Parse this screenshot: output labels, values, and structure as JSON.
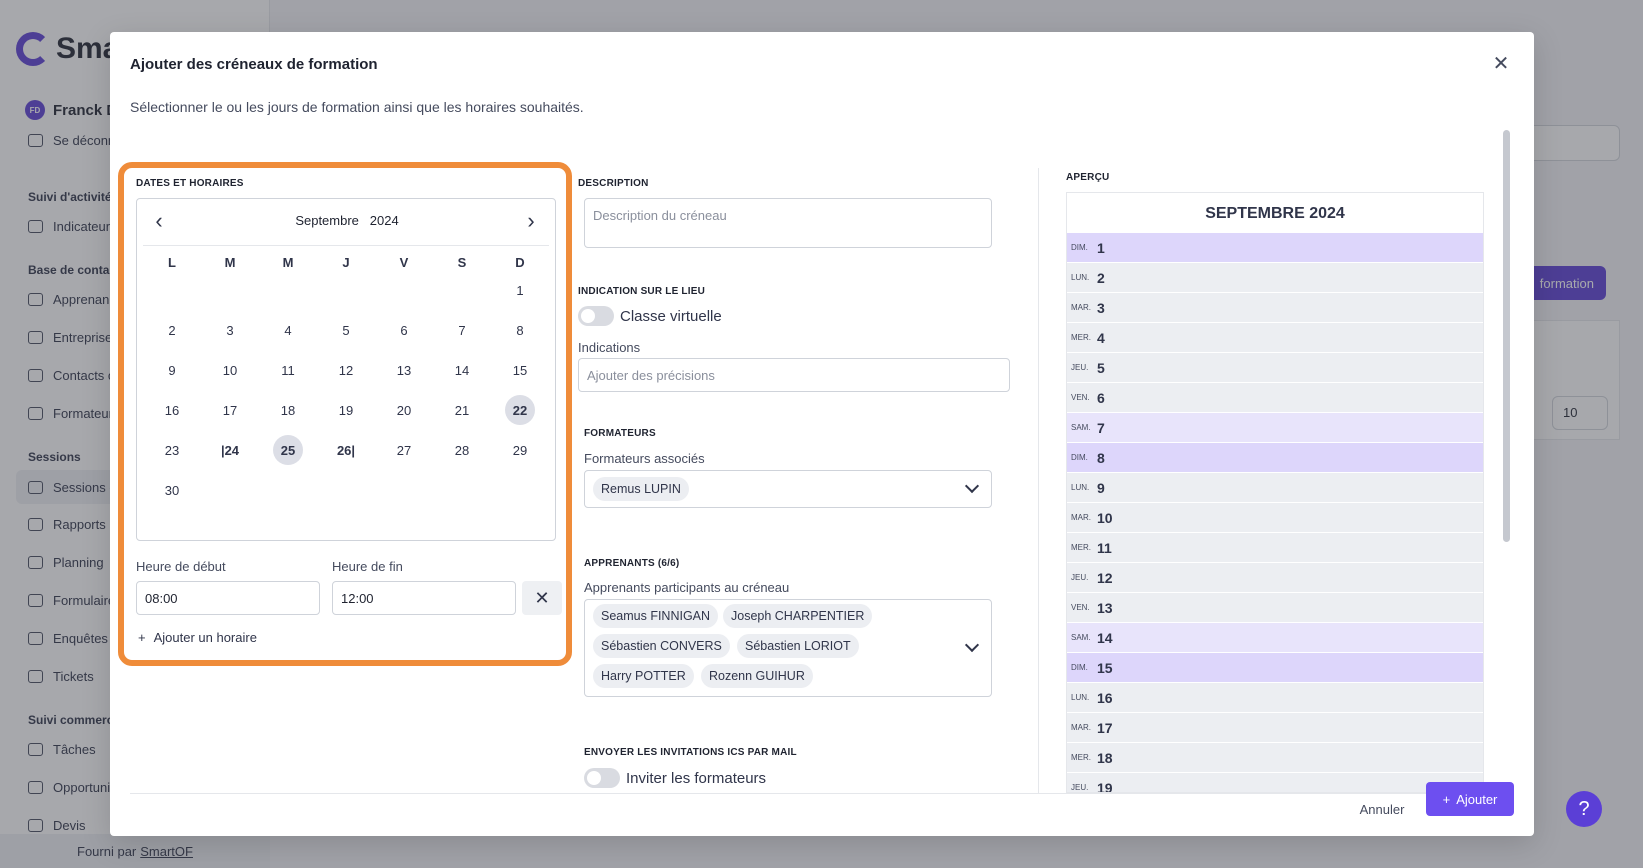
{
  "background": {
    "logo_text": "Sma",
    "user": {
      "initials": "FD",
      "name": "Franck D"
    },
    "logout": "Se déconn",
    "groups": [
      "Suivi d'activité",
      "Base de conta",
      "Sessions",
      "Suivi commerc"
    ],
    "items": [
      "Indicateur",
      "Apprenan",
      "Entreprise",
      "Contacts c",
      "Formateur",
      "Sessions d",
      "Rapports",
      "Planning",
      "Formulaire",
      "Enquêtes",
      "Tickets",
      "Tâches",
      "Opportunit",
      "Devis"
    ],
    "footer_prefix": "Fourni par",
    "footer_link": "SmartOF",
    "right_button": "formation",
    "page_size": "10",
    "help": "?"
  },
  "modal": {
    "title": "Ajouter des créneaux de formation",
    "subtitle": "Sélectionner le ou les jours de formation ainsi que les horaires souhaités.",
    "close": "✕",
    "cancel": "Annuler",
    "add": "Ajouter"
  },
  "dates": {
    "section": "DATES ET HORAIRES",
    "month": "Septembre",
    "year": "2024",
    "weekdays": [
      "L",
      "M",
      "M",
      "J",
      "V",
      "S",
      "D"
    ],
    "days": [
      "1",
      "2",
      "3",
      "4",
      "5",
      "6",
      "7",
      "8",
      "9",
      "10",
      "11",
      "12",
      "13",
      "14",
      "15",
      "16",
      "17",
      "18",
      "19",
      "20",
      "21",
      "22",
      "23",
      "|24",
      "25",
      "26|",
      "27",
      "28",
      "29",
      "30"
    ],
    "start_label": "Heure de début",
    "start_value": "08:00",
    "end_label": "Heure de fin",
    "end_value": "12:00",
    "add_hour": "Ajouter un horaire"
  },
  "description": {
    "section": "DESCRIPTION",
    "placeholder": "Description du créneau"
  },
  "location": {
    "section": "INDICATION SUR LE LIEU",
    "virtual_label": "Classe virtuelle",
    "indications_label": "Indications",
    "indications_placeholder": "Ajouter des précisions"
  },
  "trainers": {
    "section": "FORMATEURS",
    "label": "Formateurs associés",
    "selected": [
      "Remus LUPIN"
    ]
  },
  "learners": {
    "section": "APPRENANTS (6/6)",
    "label": "Apprenants participants au créneau",
    "selected": [
      "Seamus FINNIGAN",
      "Joseph CHARPENTIER",
      "Sébastien CONVERS",
      "Sébastien LORIOT",
      "Harry POTTER",
      "Rozenn GUIHUR"
    ]
  },
  "ics": {
    "section": "ENVOYER LES INVITATIONS ICS PAR MAIL",
    "invite_trainers": "Inviter les formateurs"
  },
  "preview": {
    "section": "APERÇU",
    "title": "SEPTEMBRE 2024",
    "rows": [
      {
        "dow": "DIM.",
        "num": "1"
      },
      {
        "dow": "LUN.",
        "num": "2"
      },
      {
        "dow": "MAR.",
        "num": "3"
      },
      {
        "dow": "MER.",
        "num": "4"
      },
      {
        "dow": "JEU.",
        "num": "5"
      },
      {
        "dow": "VEN.",
        "num": "6"
      },
      {
        "dow": "SAM.",
        "num": "7"
      },
      {
        "dow": "DIM.",
        "num": "8"
      },
      {
        "dow": "LUN.",
        "num": "9"
      },
      {
        "dow": "MAR.",
        "num": "10"
      },
      {
        "dow": "MER.",
        "num": "11"
      },
      {
        "dow": "JEU.",
        "num": "12"
      },
      {
        "dow": "VEN.",
        "num": "13"
      },
      {
        "dow": "SAM.",
        "num": "14"
      },
      {
        "dow": "DIM.",
        "num": "15"
      },
      {
        "dow": "LUN.",
        "num": "16"
      },
      {
        "dow": "MAR.",
        "num": "17"
      },
      {
        "dow": "MER.",
        "num": "18"
      },
      {
        "dow": "JEU.",
        "num": "19"
      }
    ]
  },
  "colors": {
    "accent": "#6d4ff0",
    "highlight_border": "#ef8c3a",
    "weekend_row": "#ddd6fb",
    "weekday_row": "#eceef2"
  }
}
